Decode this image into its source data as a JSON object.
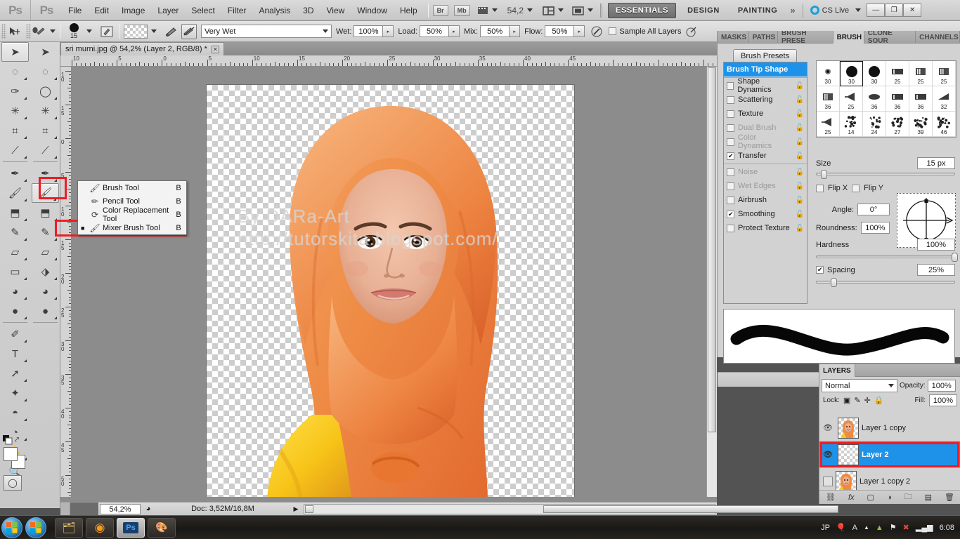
{
  "app": {
    "name": "Adobe Photoshop CS5",
    "logo": "Ps"
  },
  "menubar": {
    "items": [
      "File",
      "Edit",
      "Image",
      "Layer",
      "Select",
      "Filter",
      "Analysis",
      "3D",
      "View",
      "Window",
      "Help"
    ],
    "bridge_label": "Br",
    "minibridge_label": "Mb",
    "zoom_value": "54,2",
    "workspaces": [
      "ESSENTIALS",
      "DESIGN",
      "PAINTING"
    ],
    "more_workspaces": "»",
    "cs_live": "CS Live",
    "win_minimize": "—",
    "win_restore": "❐",
    "win_close": "✕"
  },
  "options_bar": {
    "tool_name": "Mixer Brush Tool",
    "brush_size": "15",
    "preset": "Very Wet",
    "wet_label": "Wet:",
    "wet_value": "100%",
    "load_label": "Load:",
    "load_value": "50%",
    "mix_label": "Mix:",
    "mix_value": "50%",
    "flow_label": "Flow:",
    "flow_value": "50%",
    "sample_all_layers_label": "Sample All Layers",
    "sample_all_layers_checked": false
  },
  "document": {
    "tab_title": "sri murni.jpg @ 54,2% (Layer 2, RGB/8) *",
    "close_glyph": "✕",
    "watermark_line1": "By  DARa-Art",
    "watermark_line2": "http://tutorskita.blogspot.com/"
  },
  "rulers": {
    "top_labels": [
      "10",
      "5",
      "0",
      "5",
      "10",
      "15",
      "20",
      "25",
      "30",
      "35",
      "40",
      "45"
    ],
    "left_labels": [
      "10",
      "15",
      "0",
      "5",
      "10",
      "15",
      "20",
      "25",
      "30",
      "35",
      "40",
      "45",
      "50"
    ]
  },
  "status_bar": {
    "zoom": "54,2%",
    "doc_info": "Doc: 3,52M/16,8M",
    "arrow": "▶"
  },
  "toolbox": {
    "column_a": [
      {
        "name": "move-tool",
        "glyph": "➤",
        "selected": true,
        "flyout": false
      },
      {
        "name": "marquee-tool",
        "glyph": "◌",
        "selected": false,
        "flyout": true
      },
      {
        "name": "lasso-tool",
        "glyph": "✑",
        "selected": false,
        "flyout": true
      },
      {
        "name": "quick-selection-tool",
        "glyph": "✳",
        "selected": false,
        "flyout": true
      },
      {
        "name": "crop-tool",
        "glyph": "⌗",
        "selected": false,
        "flyout": true
      },
      {
        "name": "eyedropper-tool",
        "glyph": "⟋",
        "selected": false,
        "flyout": true
      },
      {
        "name": "healing-brush-tool",
        "glyph": "✒",
        "selected": false,
        "flyout": true
      },
      {
        "name": "brush-tool",
        "glyph": "🖌",
        "selected": false,
        "flyout": true
      },
      {
        "name": "clone-stamp-tool",
        "glyph": "⬒",
        "selected": false,
        "flyout": true
      },
      {
        "name": "history-brush-tool",
        "glyph": "✎",
        "selected": false,
        "flyout": true
      },
      {
        "name": "eraser-tool",
        "glyph": "▱",
        "selected": false,
        "flyout": true
      },
      {
        "name": "gradient-tool",
        "glyph": "▭",
        "selected": false,
        "flyout": true
      },
      {
        "name": "blur-tool",
        "glyph": "◕",
        "selected": false,
        "flyout": true
      },
      {
        "name": "dodge-tool",
        "glyph": "●",
        "selected": false,
        "flyout": true
      },
      {
        "name": "pen-tool",
        "glyph": "✐",
        "selected": false,
        "flyout": true
      },
      {
        "name": "type-tool",
        "glyph": "T",
        "selected": false,
        "flyout": true
      },
      {
        "name": "path-selection-tool",
        "glyph": "➚",
        "selected": false,
        "flyout": true
      },
      {
        "name": "custom-shape-tool",
        "glyph": "✦",
        "selected": false,
        "flyout": true
      },
      {
        "name": "3d-rotate-tool",
        "glyph": "◓",
        "selected": false,
        "flyout": true
      },
      {
        "name": "3d-orbit-tool",
        "glyph": "◔",
        "selected": false,
        "flyout": true
      },
      {
        "name": "hand-tool",
        "glyph": "✋",
        "selected": false,
        "flyout": true
      },
      {
        "name": "zoom-tool",
        "glyph": "🔍",
        "selected": false,
        "flyout": false
      }
    ],
    "column_b": [
      {
        "name": "move-tool",
        "glyph": "➤",
        "selected": false,
        "flyout": false
      },
      {
        "name": "marquee-tool",
        "glyph": "◌",
        "selected": false,
        "flyout": true
      },
      {
        "name": "lasso-tool",
        "glyph": "◯",
        "selected": false,
        "flyout": true
      },
      {
        "name": "quick-selection-tool",
        "glyph": "✳",
        "selected": false,
        "flyout": true
      },
      {
        "name": "crop-tool",
        "glyph": "⌗",
        "selected": false,
        "flyout": true
      },
      {
        "name": "eyedropper-tool",
        "glyph": "⟋",
        "selected": false,
        "flyout": true
      },
      {
        "name": "healing-brush-tool",
        "glyph": "✒",
        "selected": false,
        "flyout": true
      },
      {
        "name": "brush-tool",
        "glyph": "🖌",
        "selected": true,
        "flyout": true
      },
      {
        "name": "clone-stamp-tool",
        "glyph": "⬒",
        "selected": false,
        "flyout": true
      },
      {
        "name": "history-brush-tool",
        "glyph": "✎",
        "selected": false,
        "flyout": true
      },
      {
        "name": "eraser-tool",
        "glyph": "▱",
        "selected": false,
        "flyout": true
      },
      {
        "name": "paint-bucket-tool",
        "glyph": "⬗",
        "selected": false,
        "flyout": true
      },
      {
        "name": "blur-tool",
        "glyph": "◕",
        "selected": false,
        "flyout": true
      },
      {
        "name": "dodge-tool",
        "glyph": "●",
        "selected": false,
        "flyout": true
      }
    ],
    "foreground_color": "#ffffff",
    "background_color": "#ffffff",
    "swap_glyph": "⤤",
    "quickmask_glyph": "◯"
  },
  "tool_flyout": {
    "items": [
      {
        "label": "Brush Tool",
        "shortcut": "B",
        "icon": "brush-icon",
        "active": false
      },
      {
        "label": "Pencil Tool",
        "shortcut": "B",
        "icon": "pencil-icon",
        "active": false
      },
      {
        "label": "Color Replacement Tool",
        "shortcut": "B",
        "icon": "color-replacement-icon",
        "active": false
      },
      {
        "label": "Mixer Brush Tool",
        "shortcut": "B",
        "icon": "mixer-brush-icon",
        "active": true
      }
    ],
    "highlight_color": "#ee1c24"
  },
  "brush_panel": {
    "tabs": [
      {
        "label": "MASKS",
        "active": false
      },
      {
        "label": "PATHS",
        "active": false
      },
      {
        "label": "BRUSH PRESE",
        "active": false
      },
      {
        "label": "BRUSH",
        "active": true
      },
      {
        "label": "CLONE SOUR",
        "active": false
      },
      {
        "label": "CHANNELS",
        "active": false
      }
    ],
    "presets_button": "Brush Presets",
    "options": [
      {
        "label": "Brush Tip Shape",
        "checked": null,
        "selected": true,
        "disabled": false,
        "lock": false
      },
      {
        "label": "Shape Dynamics",
        "checked": false,
        "selected": false,
        "disabled": false,
        "lock": true
      },
      {
        "label": "Scattering",
        "checked": false,
        "selected": false,
        "disabled": false,
        "lock": true
      },
      {
        "label": "Texture",
        "checked": false,
        "selected": false,
        "disabled": false,
        "lock": true
      },
      {
        "label": "Dual Brush",
        "checked": false,
        "selected": false,
        "disabled": true,
        "lock": true
      },
      {
        "label": "Color Dynamics",
        "checked": false,
        "selected": false,
        "disabled": true,
        "lock": true
      },
      {
        "label": "Transfer",
        "checked": true,
        "selected": false,
        "disabled": false,
        "lock": true
      },
      {
        "label": "Noise",
        "checked": false,
        "selected": false,
        "disabled": true,
        "lock": true
      },
      {
        "label": "Wet Edges",
        "checked": false,
        "selected": false,
        "disabled": true,
        "lock": true
      },
      {
        "label": "Airbrush",
        "checked": false,
        "selected": false,
        "disabled": false,
        "lock": true
      },
      {
        "label": "Smoothing",
        "checked": true,
        "selected": false,
        "disabled": false,
        "lock": true
      },
      {
        "label": "Protect Texture",
        "checked": false,
        "selected": false,
        "disabled": false,
        "lock": true
      }
    ],
    "tips": [
      {
        "size": "30",
        "kind": "soft",
        "selected": false
      },
      {
        "size": "30",
        "kind": "hard",
        "selected": true
      },
      {
        "size": "30",
        "kind": "hard",
        "selected": false
      },
      {
        "size": "25",
        "kind": "flat",
        "selected": false
      },
      {
        "size": "25",
        "kind": "bristle",
        "selected": false
      },
      {
        "size": "25",
        "kind": "bristle",
        "selected": false
      },
      {
        "size": "36",
        "kind": "bristle",
        "selected": false
      },
      {
        "size": "25",
        "kind": "fan",
        "selected": false
      },
      {
        "size": "36",
        "kind": "round",
        "selected": false
      },
      {
        "size": "36",
        "kind": "flat",
        "selected": false
      },
      {
        "size": "36",
        "kind": "flat",
        "selected": false
      },
      {
        "size": "32",
        "kind": "angle",
        "selected": false
      },
      {
        "size": "25",
        "kind": "fan",
        "selected": false
      },
      {
        "size": "14",
        "kind": "spatter",
        "selected": false
      },
      {
        "size": "24",
        "kind": "spatter",
        "selected": false
      },
      {
        "size": "27",
        "kind": "spatter",
        "selected": false
      },
      {
        "size": "39",
        "kind": "spatter",
        "selected": false
      },
      {
        "size": "46",
        "kind": "spatter",
        "selected": false
      }
    ],
    "size_label": "Size",
    "size_value": "15 px",
    "size_slider_pct": 5,
    "flip_x_label": "Flip X",
    "flip_x_checked": false,
    "flip_y_label": "Flip Y",
    "flip_y_checked": false,
    "angle_label": "Angle:",
    "angle_value": "0°",
    "roundness_label": "Roundness:",
    "roundness_value": "100%",
    "hardness_label": "Hardness",
    "hardness_value": "100%",
    "hardness_slider_pct": 100,
    "spacing_label": "Spacing",
    "spacing_checked": true,
    "spacing_value": "25%",
    "spacing_slider_pct": 12
  },
  "layers_panel": {
    "tab_label": "LAYERS",
    "blend_mode": "Normal",
    "opacity_label": "Opacity:",
    "opacity_value": "100%",
    "lock_label": "Lock:",
    "fill_label": "Fill:",
    "fill_value": "100%",
    "lock_icons": [
      "transparent-pixels-icon",
      "image-pixels-icon",
      "position-icon",
      "all-icon"
    ],
    "layers": [
      {
        "name": "Layer 1 copy",
        "visible": true,
        "selected": false,
        "has_image": true
      },
      {
        "name": "Layer 2",
        "visible": true,
        "selected": true,
        "has_image": false
      },
      {
        "name": "Layer 1 copy 2",
        "visible": false,
        "selected": false,
        "has_image": true
      }
    ],
    "highlight_color": "#ee1c24",
    "footer_icons": [
      "link-icon",
      "fx-icon",
      "mask-icon",
      "adjustment-icon",
      "group-icon",
      "new-layer-icon",
      "delete-icon"
    ]
  },
  "taskbar": {
    "buttons": [
      {
        "name": "explorer",
        "glyph": "🗂",
        "active": false
      },
      {
        "name": "firefox",
        "glyph": "◉",
        "active": false
      },
      {
        "name": "photoshop",
        "glyph": "Ps",
        "active": true
      },
      {
        "name": "paint",
        "glyph": "🎨",
        "active": false
      }
    ],
    "tray_lang": "JP",
    "tray_items": [
      "balloon-icon",
      "ime-a-icon",
      "chevron-up-icon",
      "drive-icon",
      "flag-icon",
      "network-icon",
      "signal-icon"
    ],
    "clock": "6:08"
  }
}
